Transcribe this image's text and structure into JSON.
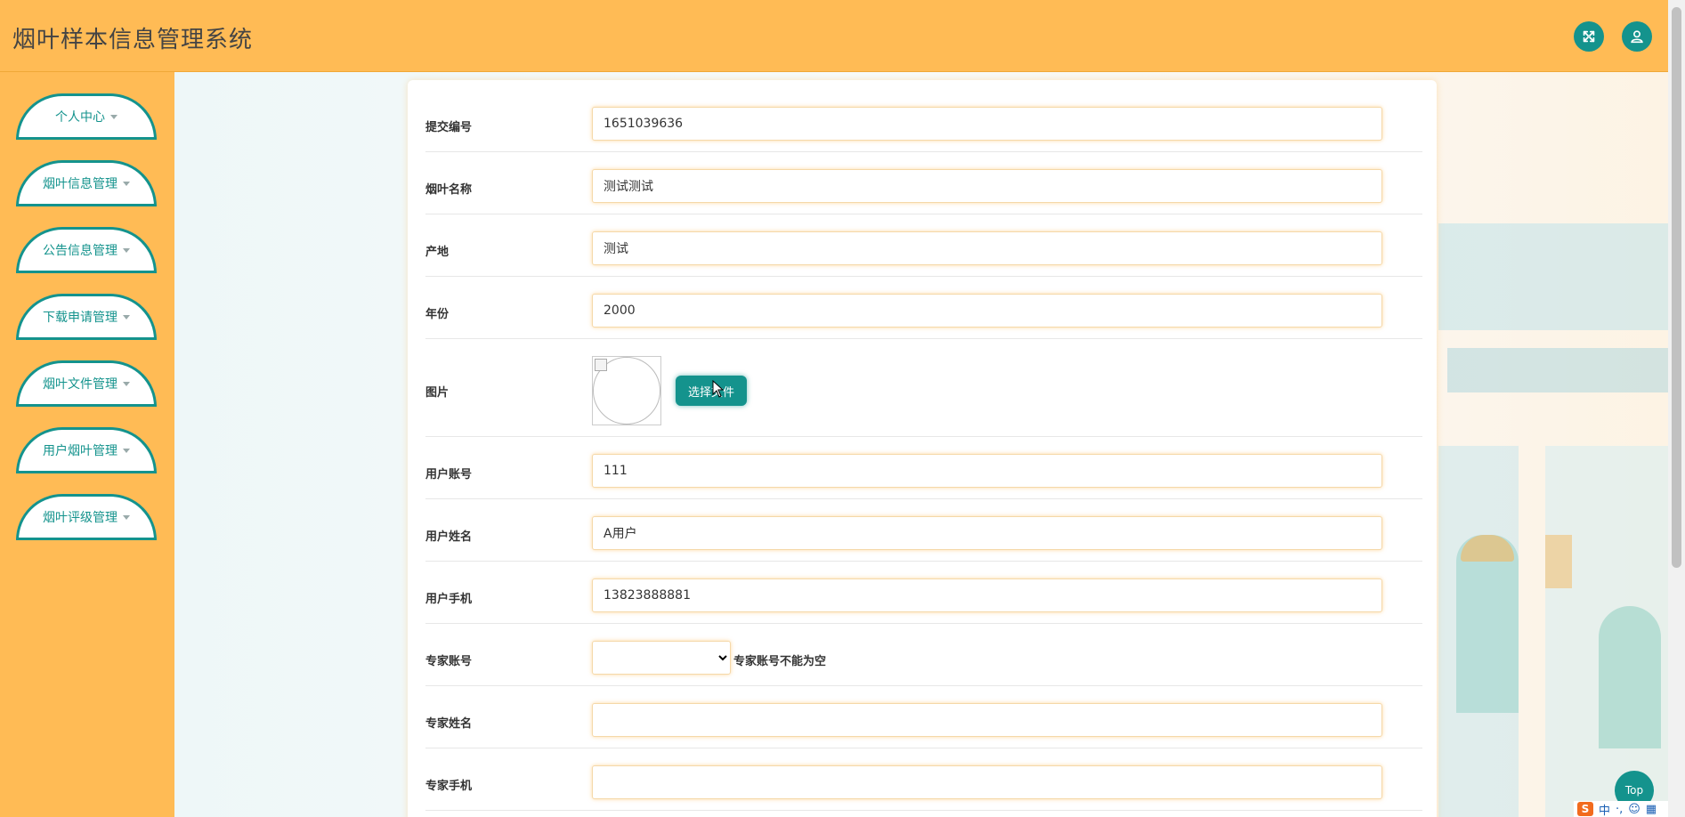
{
  "header": {
    "title": "烟叶样本信息管理系统",
    "fullscreen_icon": "fullscreen-icon",
    "user_icon": "user-icon"
  },
  "sidebar": {
    "items": [
      {
        "label": "个人中心"
      },
      {
        "label": "烟叶信息管理"
      },
      {
        "label": "公告信息管理"
      },
      {
        "label": "下载申请管理"
      },
      {
        "label": "烟叶文件管理"
      },
      {
        "label": "用户烟叶管理"
      },
      {
        "label": "烟叶评级管理"
      }
    ]
  },
  "form": {
    "submit_no": {
      "label": "提交编号",
      "value": "1651039636"
    },
    "leaf_name": {
      "label": "烟叶名称",
      "value": "测试测试"
    },
    "origin": {
      "label": "产地",
      "value": "测试"
    },
    "year": {
      "label": "年份",
      "value": "2000"
    },
    "image": {
      "label": "图片",
      "button": "选择文件"
    },
    "user_account": {
      "label": "用户账号",
      "value": "111"
    },
    "user_name": {
      "label": "用户姓名",
      "value": "A用户"
    },
    "user_phone": {
      "label": "用户手机",
      "value": "13823888881"
    },
    "expert_account": {
      "label": "专家账号",
      "selected": "",
      "error": "专家账号不能为空"
    },
    "expert_name": {
      "label": "专家姓名",
      "value": ""
    },
    "expert_phone": {
      "label": "专家手机",
      "value": ""
    }
  },
  "top_button": "Top",
  "ime": {
    "logo": "S",
    "mode": "中"
  },
  "colors": {
    "header_bg": "#ffbb55",
    "accent": "#14938d",
    "sidebar_bg": "#ffbb55"
  }
}
